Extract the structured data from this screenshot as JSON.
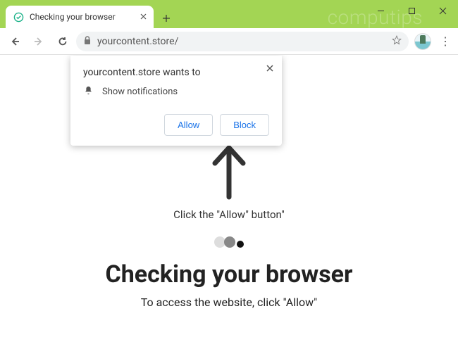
{
  "watermark": "computips",
  "tab": {
    "title": "Checking your browser"
  },
  "omnibox": {
    "url": "yourcontent.store/"
  },
  "permission_prompt": {
    "header": "yourcontent.store wants to",
    "item": "Show notifications",
    "allow_label": "Allow",
    "block_label": "Block"
  },
  "page": {
    "instruction": "Click the \"Allow\" button\"",
    "heading": "Checking your browser",
    "subline": "To access the website, click \"Allow\""
  }
}
